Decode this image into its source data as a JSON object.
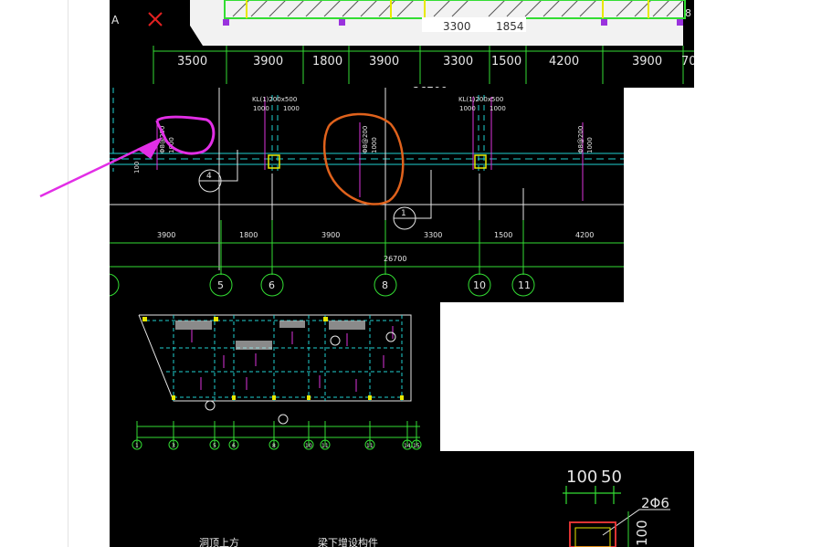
{
  "panel_top": {
    "axis_label": "A",
    "marker": "X",
    "sub_dims": [
      "3300",
      "1854"
    ],
    "dims": [
      "3500",
      "3900",
      "1800",
      "3900",
      "3300",
      "1500",
      "4200",
      "3900",
      "70"
    ],
    "edge_label": "8",
    "cut_label": "26700"
  },
  "panel_middle": {
    "beam_labels": [
      "1000",
      "1000",
      "1000",
      "1000"
    ],
    "beam_codes": [
      "KL(1)200x500",
      "KL(1)200x500",
      "KL(1)200x500",
      "KL(1)200x500"
    ],
    "col_notes": [
      "Φ8@200",
      "Φ8@200",
      "Φ8@200",
      "Φ8@200"
    ],
    "side_labels": [
      "100",
      "1000",
      "1000",
      "1000"
    ],
    "section_marks": [
      "4",
      "1"
    ],
    "dims": [
      "3900",
      "1800",
      "3900",
      "3300",
      "1500",
      "4200"
    ],
    "total_dim": "26700",
    "axes": [
      "5",
      "6",
      "8",
      "10",
      "11"
    ]
  },
  "panel_plan": {
    "axes": [
      "1",
      "3",
      "5",
      "6",
      "8",
      "10",
      "11",
      "14",
      "15"
    ]
  },
  "panel_detail": {
    "dims": [
      "100",
      "50"
    ],
    "rebar": "2Φ6",
    "vertical_dim": "100",
    "notes": [
      "洞顶上方",
      "梁下增设构件"
    ]
  },
  "colors": {
    "magenta_annotation": "#e22ee6",
    "orange_annotation": "#e0621c",
    "cad_green": "#33dd33",
    "cad_cyan": "#20d0d0",
    "cad_yellow": "#e8e800",
    "cad_magenta": "#dd33dd",
    "cad_white": "#e6e6e6"
  }
}
